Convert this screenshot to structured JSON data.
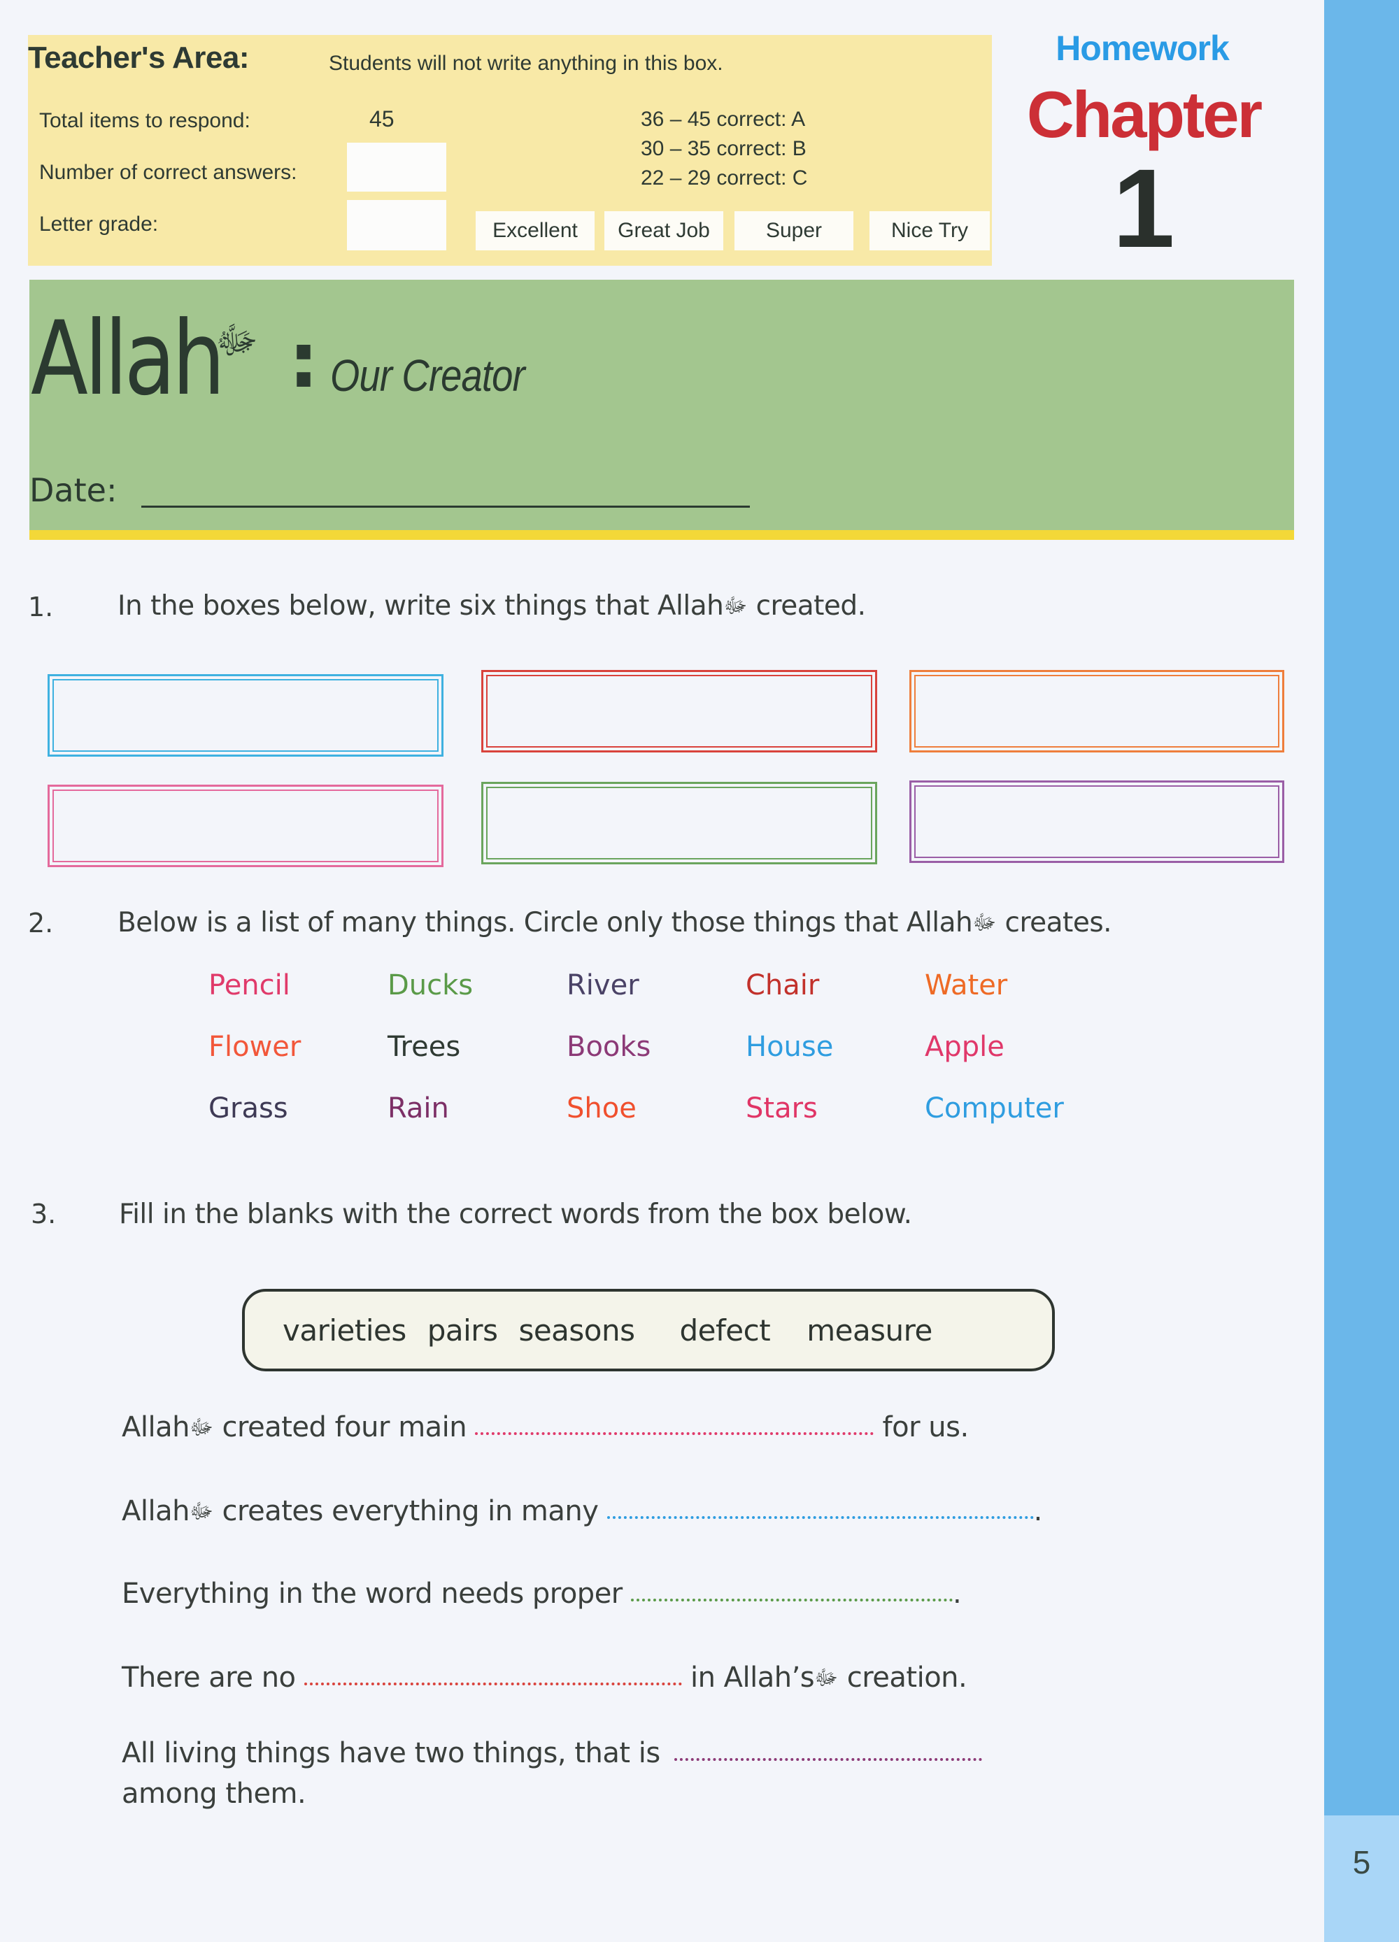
{
  "teacher_area": {
    "title": "Teacher's Area:",
    "note": "Students will not write anything in this box.",
    "total_label": "Total items to respond:",
    "total_value": "45",
    "correct_label": "Number of correct answers:",
    "grade_label": "Letter grade:",
    "grading_scale": [
      "36 – 45 correct: A",
      "30 – 35 correct: B",
      "22 – 29 correct: C"
    ],
    "praise_options": [
      "Excellent",
      "Great Job",
      "Super",
      "Nice Try"
    ]
  },
  "header": {
    "homework_label": "Homework",
    "chapter_label": "Chapter",
    "chapter_number": "1"
  },
  "title_banner": {
    "main": "Allah",
    "honorific": "ﷻ",
    "colon": ":",
    "subtitle": "Our Creator",
    "date_label": "Date:"
  },
  "questions": {
    "q1": {
      "number": "1.",
      "text_before": "In the boxes below, write six things that Allah",
      "text_after": " created.",
      "box_colors": [
        "#3fb1e0",
        "#d9433c",
        "#ee7e3c",
        "#e46a9c",
        "#6aa55d",
        "#9a5ea6"
      ]
    },
    "q2": {
      "number": "2.",
      "text_before": "Below is a list of many things. Circle only those things that Allah",
      "text_after": " creates.",
      "words": [
        {
          "label": "Pencil",
          "color": "#e03a6a"
        },
        {
          "label": "Ducks",
          "color": "#5a9a48"
        },
        {
          "label": "River",
          "color": "#4a4266"
        },
        {
          "label": "Chair",
          "color": "#c2312b"
        },
        {
          "label": "Water",
          "color": "#ee6a25"
        },
        {
          "label": "Flower",
          "color": "#f2573a"
        },
        {
          "label": "Trees",
          "color": "#2f3a33"
        },
        {
          "label": "Books",
          "color": "#8c3a77"
        },
        {
          "label": "House",
          "color": "#2f9de0"
        },
        {
          "label": "Apple",
          "color": "#e0386a"
        },
        {
          "label": "Grass",
          "color": "#3e3a55"
        },
        {
          "label": "Rain",
          "color": "#7c2f66"
        },
        {
          "label": "Shoe",
          "color": "#f0502e"
        },
        {
          "label": "Stars",
          "color": "#e03566"
        },
        {
          "label": "Computer",
          "color": "#2f9de0"
        }
      ]
    },
    "q3": {
      "number": "3.",
      "text": "Fill in the blanks with the correct words from the box below.",
      "word_bank": [
        "varieties",
        "pairs",
        "seasons",
        "defect",
        "measure"
      ],
      "sentences": [
        {
          "before": "Allah",
          "honorific": "ﷻ",
          "middle": " created four main ",
          "after": " for us.",
          "dot_color": "#e03a6a"
        },
        {
          "before": "Allah",
          "honorific": "ﷻ",
          "middle": " creates everything in many ",
          "after": ".",
          "dot_color": "#2f9de0"
        },
        {
          "before": "Everything in the word needs proper ",
          "honorific": "",
          "middle": "",
          "after": ".",
          "dot_color": "#5a9a48"
        },
        {
          "before": "There are no ",
          "honorific": "",
          "middle": "",
          "after": " in Allah’s",
          "after_honorific": "ﷻ",
          "after_end": " creation.",
          "dot_color": "#d9433c"
        },
        {
          "before": "All living things have two things, that is ",
          "honorific": "",
          "middle": "",
          "after": "",
          "line2": "among them.",
          "dot_color": "#8c3a77"
        }
      ]
    }
  },
  "page": {
    "number": "5",
    "accent_blue": "#6bb7ea",
    "banner_green": "#a3c68f",
    "teacher_yellow": "#f8e9a7"
  }
}
